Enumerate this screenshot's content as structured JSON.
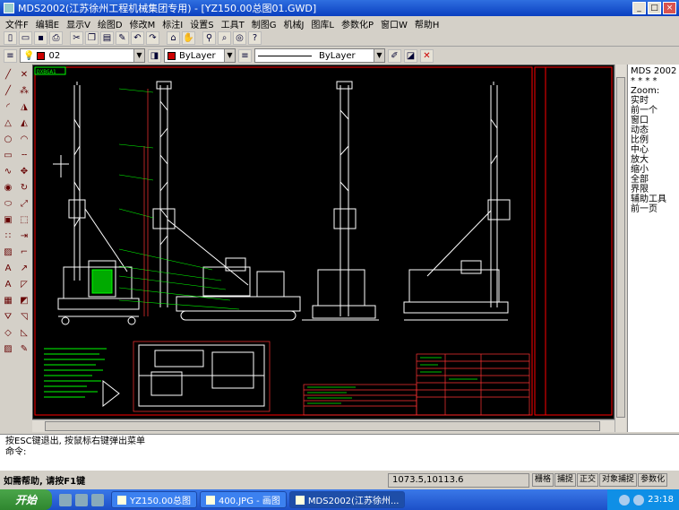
{
  "window": {
    "title": "MDS2002(江苏徐州工程机械集团专用) - [YZ150.00总图01.GWD]"
  },
  "menu": [
    "文件F",
    "编辑E",
    "显示V",
    "绘图D",
    "修改M",
    "标注I",
    "设置S",
    "工具T",
    "制图G",
    "机械J",
    "图库L",
    "参数化P",
    "窗口W",
    "帮助H"
  ],
  "toolbar2": {
    "layer": "02",
    "color": "ByLayer",
    "linetype": "ByLayer"
  },
  "canvas": {
    "sheet_tag": "DXBGA1"
  },
  "right_panel": [
    "MDS 2002",
    "* * * *",
    "Zoom:",
    "",
    "实时",
    "",
    "前一个",
    "窗口",
    "动态",
    "比例",
    "中心",
    "",
    "放大",
    "缩小",
    "",
    "全部",
    "界限",
    "",
    "",
    "",
    "",
    "",
    "",
    "",
    "",
    "",
    "",
    "",
    "辅助工具",
    "前一页"
  ],
  "command": {
    "line1": "按ESC键退出, 按鼠标右键弹出菜单",
    "line2": "命令:"
  },
  "status": {
    "help": "如需帮助, 请按F1键",
    "coords": "1073.5,10113.6",
    "modes": [
      "栅格",
      "捕捉",
      "正交",
      "对象捕捉",
      "参数化"
    ]
  },
  "taskbar": {
    "start": "开始",
    "tasks": [
      "YZ150.00总图",
      "400.JPG - 画图",
      "MDS2002(江苏徐州..."
    ],
    "clock": "23:18"
  },
  "colors": {
    "canvas_bg": "#000000",
    "drawing": "#ffffff",
    "annotation": "#00ff00",
    "frame": "#ff0000"
  }
}
